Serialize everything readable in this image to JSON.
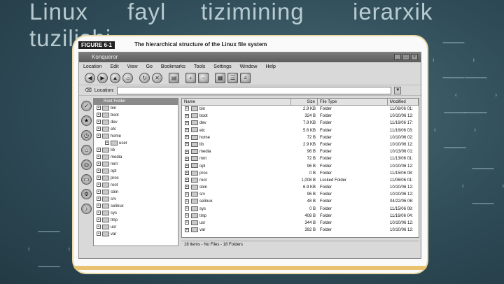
{
  "slide": {
    "title_words": [
      "Linux",
      "fayl",
      "tizimining",
      "ierarxik",
      "tuzilishi"
    ]
  },
  "figure": {
    "label": "FIGURE 6-1",
    "caption": "The hierarchical structure of the Linux file system"
  },
  "window": {
    "title": "Konqueror",
    "controls": [
      "_",
      "□",
      "×"
    ],
    "menus": [
      "Location",
      "Edit",
      "View",
      "Go",
      "Bookmarks",
      "Tools",
      "Settings",
      "Window",
      "Help"
    ],
    "location_label": "Location:",
    "tree_header": "Root Folder",
    "tree": [
      "bin",
      "boot",
      "dev",
      "etc",
      "home",
      "user",
      "lib",
      "media",
      "mnt",
      "opt",
      "proc",
      "root",
      "sbin",
      "srv",
      "selinux",
      "sys",
      "tmp",
      "usr",
      "var"
    ],
    "columns": {
      "name": "Name",
      "size": "Size",
      "type": "File Type",
      "modified": "Modified"
    },
    "files": [
      {
        "name": "bin",
        "size": "2.9 KB",
        "type": "Folder",
        "modified": "11/06/06 01:"
      },
      {
        "name": "boot",
        "size": "324 B",
        "type": "Folder",
        "modified": "10/10/06 12:"
      },
      {
        "name": "dev",
        "size": "7.9 KB",
        "type": "Folder",
        "modified": "11/16/06 17:"
      },
      {
        "name": "etc",
        "size": "5.6 KB",
        "type": "Folder",
        "modified": "11/16/06 03:"
      },
      {
        "name": "home",
        "size": "72 B",
        "type": "Folder",
        "modified": "10/10/06 02:"
      },
      {
        "name": "lib",
        "size": "2.9 KB",
        "type": "Folder",
        "modified": "10/10/06 12:"
      },
      {
        "name": "media",
        "size": "96 B",
        "type": "Folder",
        "modified": "10/13/06 01:"
      },
      {
        "name": "mnt",
        "size": "72 B",
        "type": "Folder",
        "modified": "11/13/06 01:"
      },
      {
        "name": "opt",
        "size": "96 B",
        "type": "Folder",
        "modified": "10/10/06 12:"
      },
      {
        "name": "proc",
        "size": "0 B",
        "type": "Folder",
        "modified": "11/15/06 08:"
      },
      {
        "name": "root",
        "size": "1,008 B",
        "type": "Locked Folder",
        "modified": "11/06/06 01:"
      },
      {
        "name": "sbin",
        "size": "6.9 KB",
        "type": "Folder",
        "modified": "10/10/06 12:"
      },
      {
        "name": "srv",
        "size": "96 B",
        "type": "Folder",
        "modified": "10/10/06 12:"
      },
      {
        "name": "selinux",
        "size": "48 B",
        "type": "Folder",
        "modified": "04/22/06 06:"
      },
      {
        "name": "sys",
        "size": "0 B",
        "type": "Folder",
        "modified": "11/15/06 08:"
      },
      {
        "name": "tmp",
        "size": "408 B",
        "type": "Folder",
        "modified": "11/16/06 04:"
      },
      {
        "name": "usr",
        "size": "344 B",
        "type": "Folder",
        "modified": "10/10/06 12:"
      },
      {
        "name": "var",
        "size": "392 B",
        "type": "Folder",
        "modified": "10/10/06 12:"
      }
    ],
    "status": "18 Items - No Files - 18 Folders"
  },
  "colors": {
    "accent": "#e8c270",
    "background": "#2f4a55"
  }
}
